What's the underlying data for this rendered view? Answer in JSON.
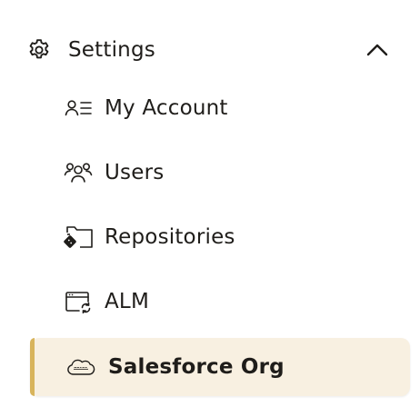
{
  "settings": {
    "label": "Settings",
    "expanded": true
  },
  "nav": {
    "items": [
      {
        "label": "My Account",
        "icon": "account-list-icon",
        "active": false
      },
      {
        "label": "Users",
        "icon": "users-icon",
        "active": false
      },
      {
        "label": "Repositories",
        "icon": "repository-icon",
        "active": false
      },
      {
        "label": "ALM",
        "icon": "alm-window-sync-icon",
        "active": false
      },
      {
        "label": "Salesforce Org",
        "icon": "salesforce-cloud-icon",
        "active": true
      }
    ]
  },
  "colors": {
    "text": "#1f1d1a",
    "active_background": "#f8f0e1",
    "active_accent": "#d8b45c"
  }
}
